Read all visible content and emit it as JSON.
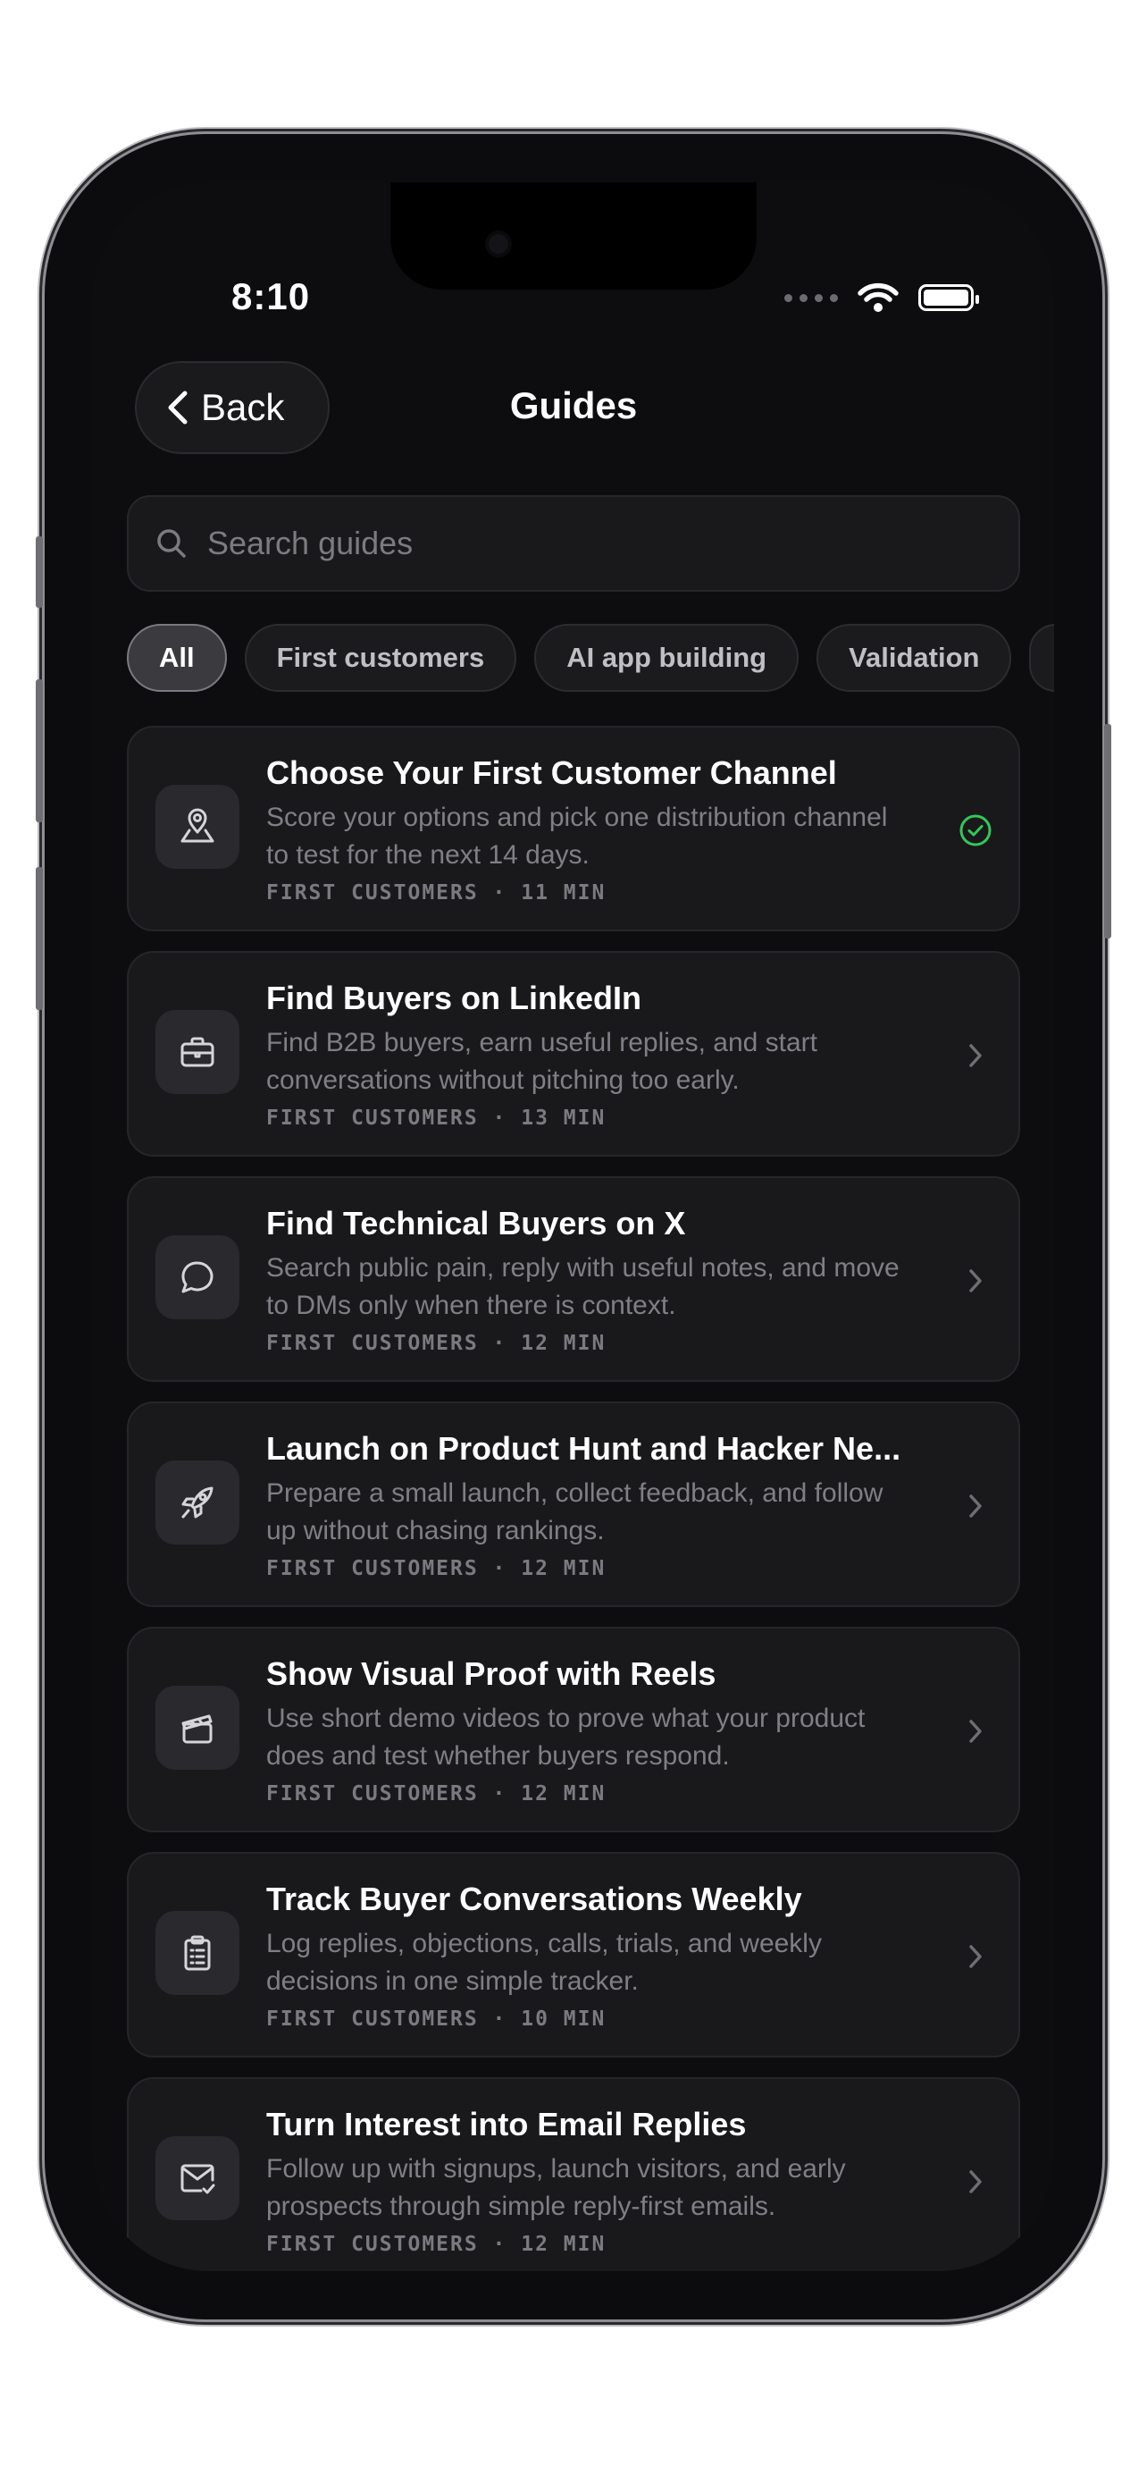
{
  "status_bar": {
    "time": "8:10"
  },
  "nav": {
    "back_label": "Back",
    "title": "Guides"
  },
  "search": {
    "placeholder": "Search guides"
  },
  "filters": [
    {
      "label": "All",
      "active": true
    },
    {
      "label": "First customers",
      "active": false
    },
    {
      "label": "AI app building",
      "active": false
    },
    {
      "label": "Validation",
      "active": false
    }
  ],
  "guides": [
    {
      "title": "Choose Your First Customer Channel",
      "description": "Score your options and pick one distribution channel to test for the next 14 days.",
      "meta": "FIRST CUSTOMERS · 11 MIN",
      "icon": "map-pin-icon",
      "status": "completed"
    },
    {
      "title": "Find Buyers on LinkedIn",
      "description": "Find B2B buyers, earn useful replies, and start conversations without pitching too early.",
      "meta": "FIRST CUSTOMERS · 13 MIN",
      "icon": "briefcase-icon",
      "status": "open"
    },
    {
      "title": "Find Technical Buyers on X",
      "description": "Search public pain, reply with useful notes, and move to DMs only when there is context.",
      "meta": "FIRST CUSTOMERS · 12 MIN",
      "icon": "chat-bubble-icon",
      "status": "open"
    },
    {
      "title": "Launch on Product Hunt and Hacker Ne...",
      "description": "Prepare a small launch, collect feedback, and follow up without chasing rankings.",
      "meta": "FIRST CUSTOMERS · 12 MIN",
      "icon": "rocket-icon",
      "status": "open"
    },
    {
      "title": "Show Visual Proof with Reels",
      "description": "Use short demo videos to prove what your product does and test whether buyers respond.",
      "meta": "FIRST CUSTOMERS · 12 MIN",
      "icon": "clapperboard-icon",
      "status": "open"
    },
    {
      "title": "Track Buyer Conversations Weekly",
      "description": "Log replies, objections, calls, trials, and weekly decisions in one simple tracker.",
      "meta": "FIRST CUSTOMERS · 10 MIN",
      "icon": "clipboard-list-icon",
      "status": "open"
    },
    {
      "title": "Turn Interest into Email Replies",
      "description": "Follow up with signups, launch visitors, and early prospects through simple reply-first emails.",
      "meta": "FIRST CUSTOMERS · 12 MIN",
      "icon": "mail-check-icon",
      "status": "open"
    }
  ],
  "colors": {
    "accent_check": "#34c759",
    "background": "#0d0d0f",
    "card": "#19191c"
  }
}
